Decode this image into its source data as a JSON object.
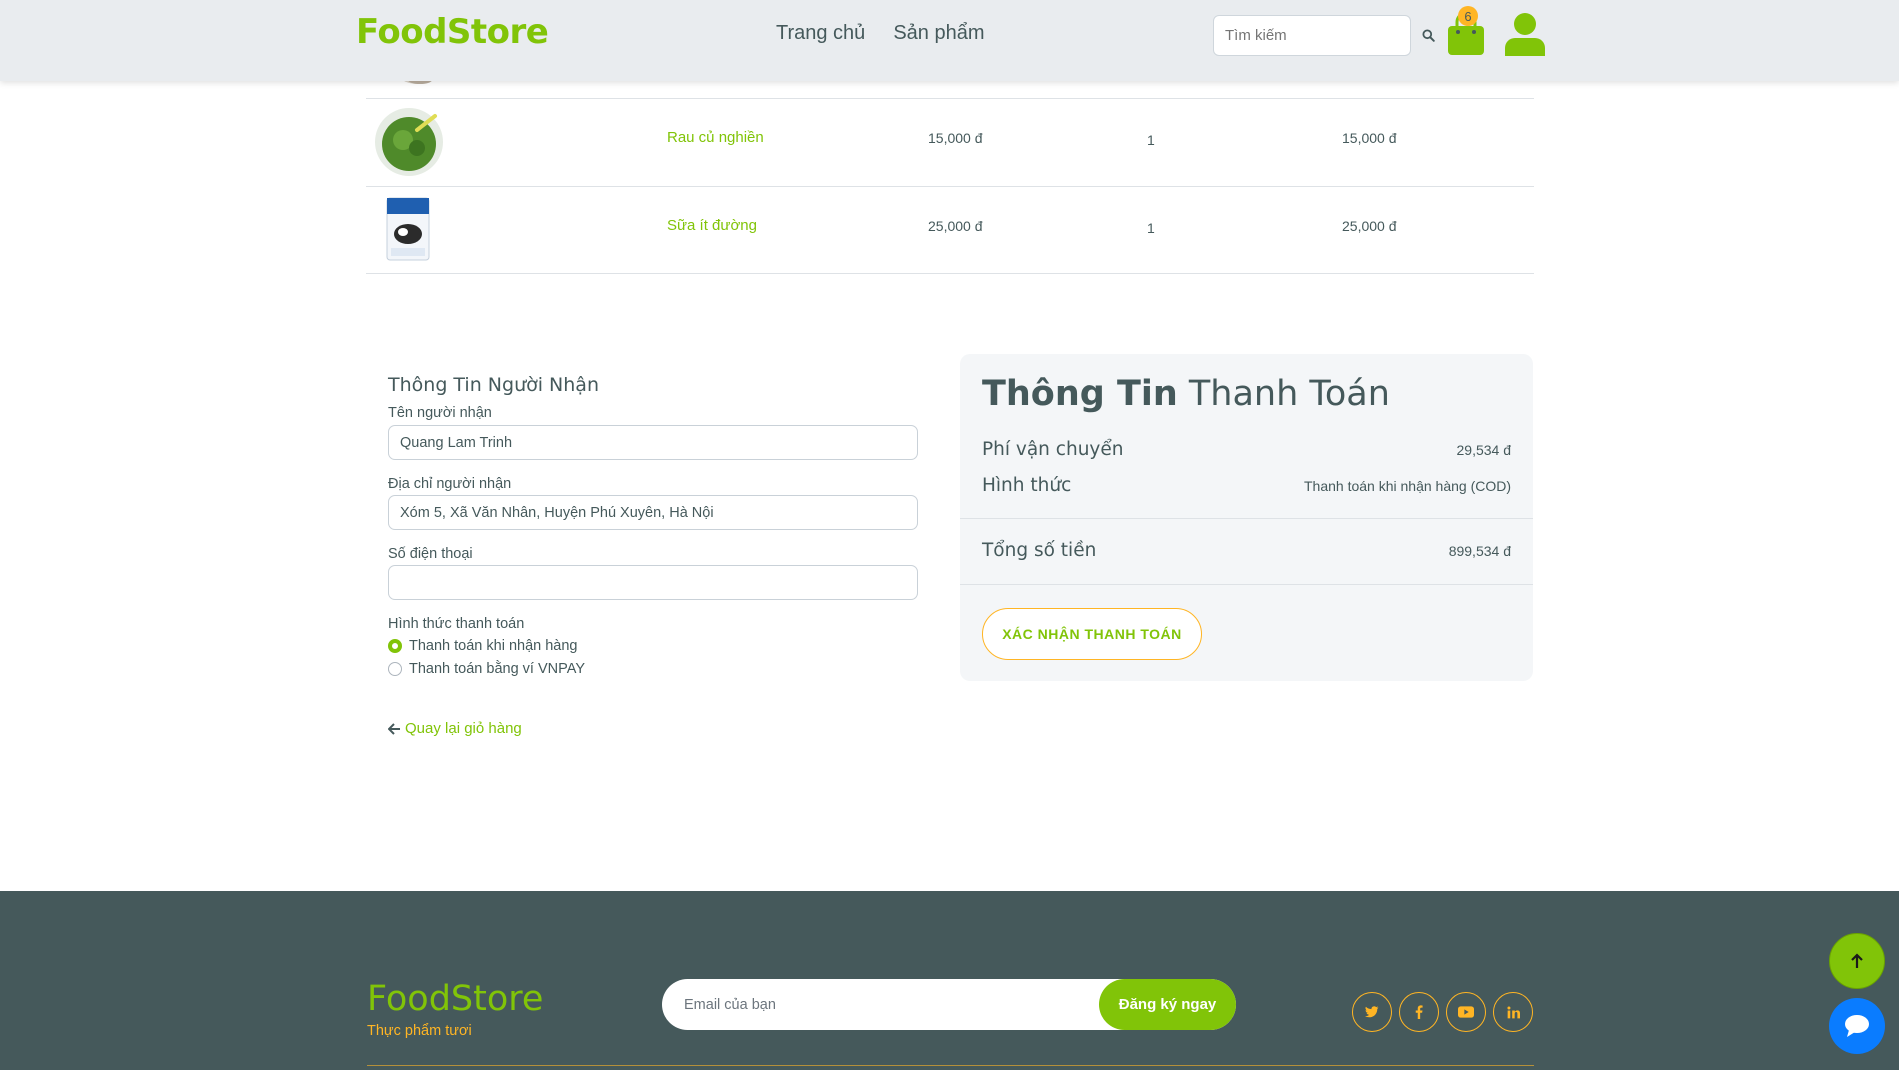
{
  "header": {
    "logo": "FoodStore",
    "nav": [
      "Trang chủ",
      "Sản phẩm"
    ],
    "search_placeholder": "Tìm kiếm",
    "cart_count": "6"
  },
  "products": [
    {
      "name": "Rau củ nghiền",
      "price": "15,000 đ",
      "qty": "1",
      "total": "15,000 đ",
      "image": "veggie-puree-bowl"
    },
    {
      "name": "Sữa ít đường",
      "price": "25,000 đ",
      "qty": "1",
      "total": "25,000 đ",
      "image": "milk-carton"
    }
  ],
  "recipient": {
    "title": "Thông Tin Người Nhận",
    "name_label": "Tên người nhận",
    "name_value": "Quang Lam Trinh",
    "address_label": "Địa chỉ người nhận",
    "address_value": "Xóm 5, Xã Văn Nhân, Huyện Phú Xuyên, Hà Nội",
    "phone_label": "Số điện thoại",
    "phone_value": "",
    "payment_label": "Hình thức thanh toán",
    "payment_options": [
      "Thanh toán khi nhận hàng",
      "Thanh toán bằng ví VNPAY"
    ],
    "selected_payment": 0,
    "back_link": "Quay lại giỏ hàng"
  },
  "payment": {
    "title_bold": "Thông Tin",
    "title_rest": "Thanh Toán",
    "shipping_label": "Phí vận chuyển",
    "shipping_value": "29,534 đ",
    "method_label": "Hình thức",
    "method_value": "Thanh toán khi nhận hàng (COD)",
    "total_label": "Tổng số tiền",
    "total_value": "899,534 đ",
    "confirm_button": "XÁC NHẬN THANH TOÁN"
  },
  "footer": {
    "logo": "FoodStore",
    "tagline": "Thực phẩm tươi",
    "email_placeholder": "Email của bạn",
    "subscribe_button": "Đăng ký ngay",
    "socials": [
      "twitter-icon",
      "facebook-icon",
      "youtube-icon",
      "linkedin-icon"
    ]
  },
  "colors": {
    "brand_green": "#81c408",
    "accent_orange": "#ffb524",
    "text_dark": "#45595b",
    "footer_bg": "#45595b",
    "chat_blue": "#0a7cff"
  }
}
